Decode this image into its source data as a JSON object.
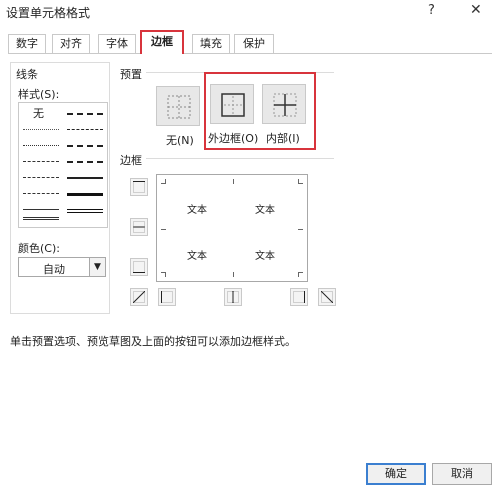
{
  "window": {
    "title": "设置单元格格式",
    "help": "?",
    "close": "✕"
  },
  "tabs": [
    {
      "label": "数字"
    },
    {
      "label": "对齐"
    },
    {
      "label": "字体"
    },
    {
      "label": "边框"
    },
    {
      "label": "填充"
    },
    {
      "label": "保护"
    }
  ],
  "active_tab": "边框",
  "line": {
    "section": "线条",
    "style_label": "样式(S):",
    "none_label": "无",
    "color_label": "颜色(C):",
    "color_value": "自动"
  },
  "presets": {
    "section": "预置",
    "items": [
      {
        "label": "无(N)"
      },
      {
        "label": "外边框(O)"
      },
      {
        "label": "内部(I)"
      }
    ]
  },
  "border": {
    "section": "边框",
    "preview_text": [
      "文本",
      "文本",
      "文本",
      "文本"
    ]
  },
  "hint": "单击预置选项、预览草图及上面的按钮可以添加边框样式。",
  "footer": {
    "ok": "确定",
    "cancel": "取消"
  },
  "colors": {
    "accent_red": "#d8343c",
    "default_blue": "#3b7fd0"
  }
}
